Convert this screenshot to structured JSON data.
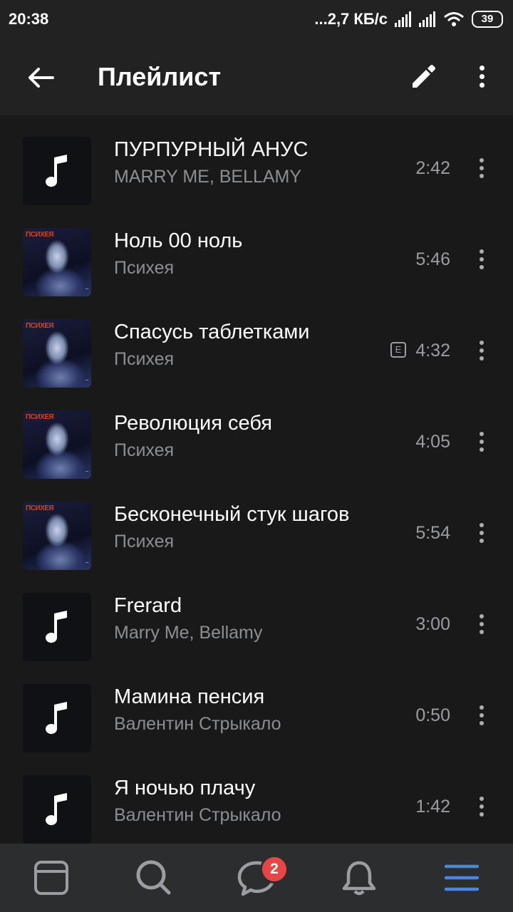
{
  "status": {
    "time": "20:38",
    "net_speed": "...2,7 КБ/с",
    "battery": "39"
  },
  "header": {
    "title": "Плейлист"
  },
  "tracks": [
    {
      "title": "ПУРПУРНЫЙ АНУС",
      "artist": "MARRY ME, BELLAMY",
      "duration": "2:42",
      "cover": "note-icon",
      "explicit": false
    },
    {
      "title": "Ноль 00 ноль",
      "artist": "Психея",
      "duration": "5:46",
      "cover": "album-art",
      "explicit": false
    },
    {
      "title": "Спасусь таблетками",
      "artist": "Психея",
      "duration": "4:32",
      "cover": "album-art",
      "explicit": true,
      "explicit_label": "E"
    },
    {
      "title": "Революция себя",
      "artist": "Психея",
      "duration": "4:05",
      "cover": "album-art",
      "explicit": false
    },
    {
      "title": "Бесконечный стук шагов",
      "artist": "Психея",
      "duration": "5:54",
      "cover": "album-art",
      "explicit": false
    },
    {
      "title": "Frerard",
      "artist": "Marry Me, Bellamy",
      "duration": "3:00",
      "cover": "note-icon",
      "explicit": false
    },
    {
      "title": "Мамина пенсия",
      "artist": "Валентин Стрыкало",
      "duration": "0:50",
      "cover": "note-icon",
      "explicit": false
    },
    {
      "title": "Я ночью плачу",
      "artist": "Валентин Стрыкало",
      "duration": "1:42",
      "cover": "note-icon",
      "explicit": false
    }
  ],
  "tabbar": {
    "messages_badge": "2",
    "accent": "#4a86e0"
  }
}
